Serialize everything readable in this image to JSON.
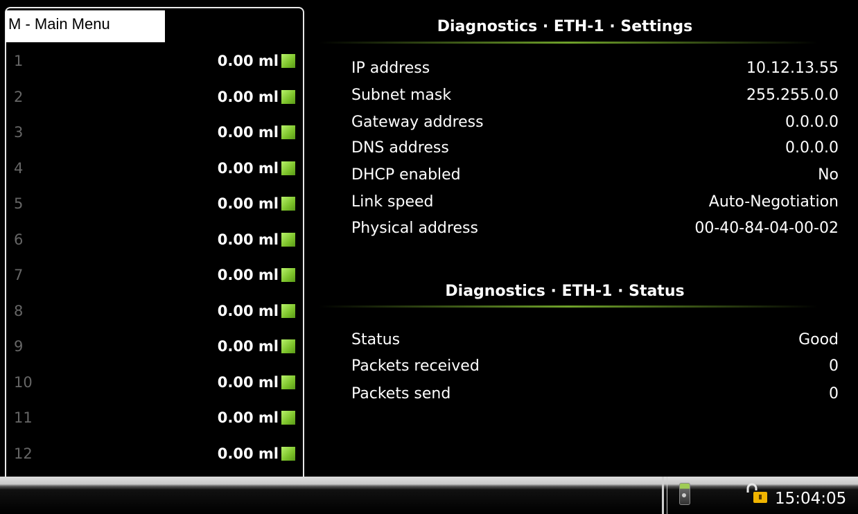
{
  "menu": {
    "title": "M - Main Menu"
  },
  "channels": [
    {
      "num": "1",
      "value": "0.00 ml"
    },
    {
      "num": "2",
      "value": "0.00 ml"
    },
    {
      "num": "3",
      "value": "0.00 ml"
    },
    {
      "num": "4",
      "value": "0.00 ml"
    },
    {
      "num": "5",
      "value": "0.00 ml"
    },
    {
      "num": "6",
      "value": "0.00 ml"
    },
    {
      "num": "7",
      "value": "0.00 ml"
    },
    {
      "num": "8",
      "value": "0.00 ml"
    },
    {
      "num": "9",
      "value": "0.00 ml"
    },
    {
      "num": "10",
      "value": "0.00 ml"
    },
    {
      "num": "11",
      "value": "0.00 ml"
    },
    {
      "num": "12",
      "value": "0.00 ml"
    }
  ],
  "settings": {
    "title": "Diagnostics · ETH-1 · Settings",
    "rows": [
      {
        "label": "IP address",
        "value": "10.12.13.55"
      },
      {
        "label": "Subnet mask",
        "value": "255.255.0.0"
      },
      {
        "label": "Gateway address",
        "value": "0.0.0.0"
      },
      {
        "label": "DNS address",
        "value": "0.0.0.0"
      },
      {
        "label": "DHCP enabled",
        "value": "No"
      },
      {
        "label": "Link speed",
        "value": "Auto-Negotiation"
      },
      {
        "label": "Physical address",
        "value": "00-40-84-04-00-02"
      }
    ]
  },
  "status": {
    "title": "Diagnostics · ETH-1 · Status",
    "rows": [
      {
        "label": "Status",
        "value": "Good"
      },
      {
        "label": "Packets received",
        "value": "0"
      },
      {
        "label": "Packets send",
        "value": "0"
      }
    ]
  },
  "statusbar": {
    "time": "15:04:05",
    "icons": [
      "device-icon",
      "lock-icon"
    ]
  },
  "colors": {
    "led": "#8fd13a",
    "accent_rule": "#6fa12a"
  }
}
